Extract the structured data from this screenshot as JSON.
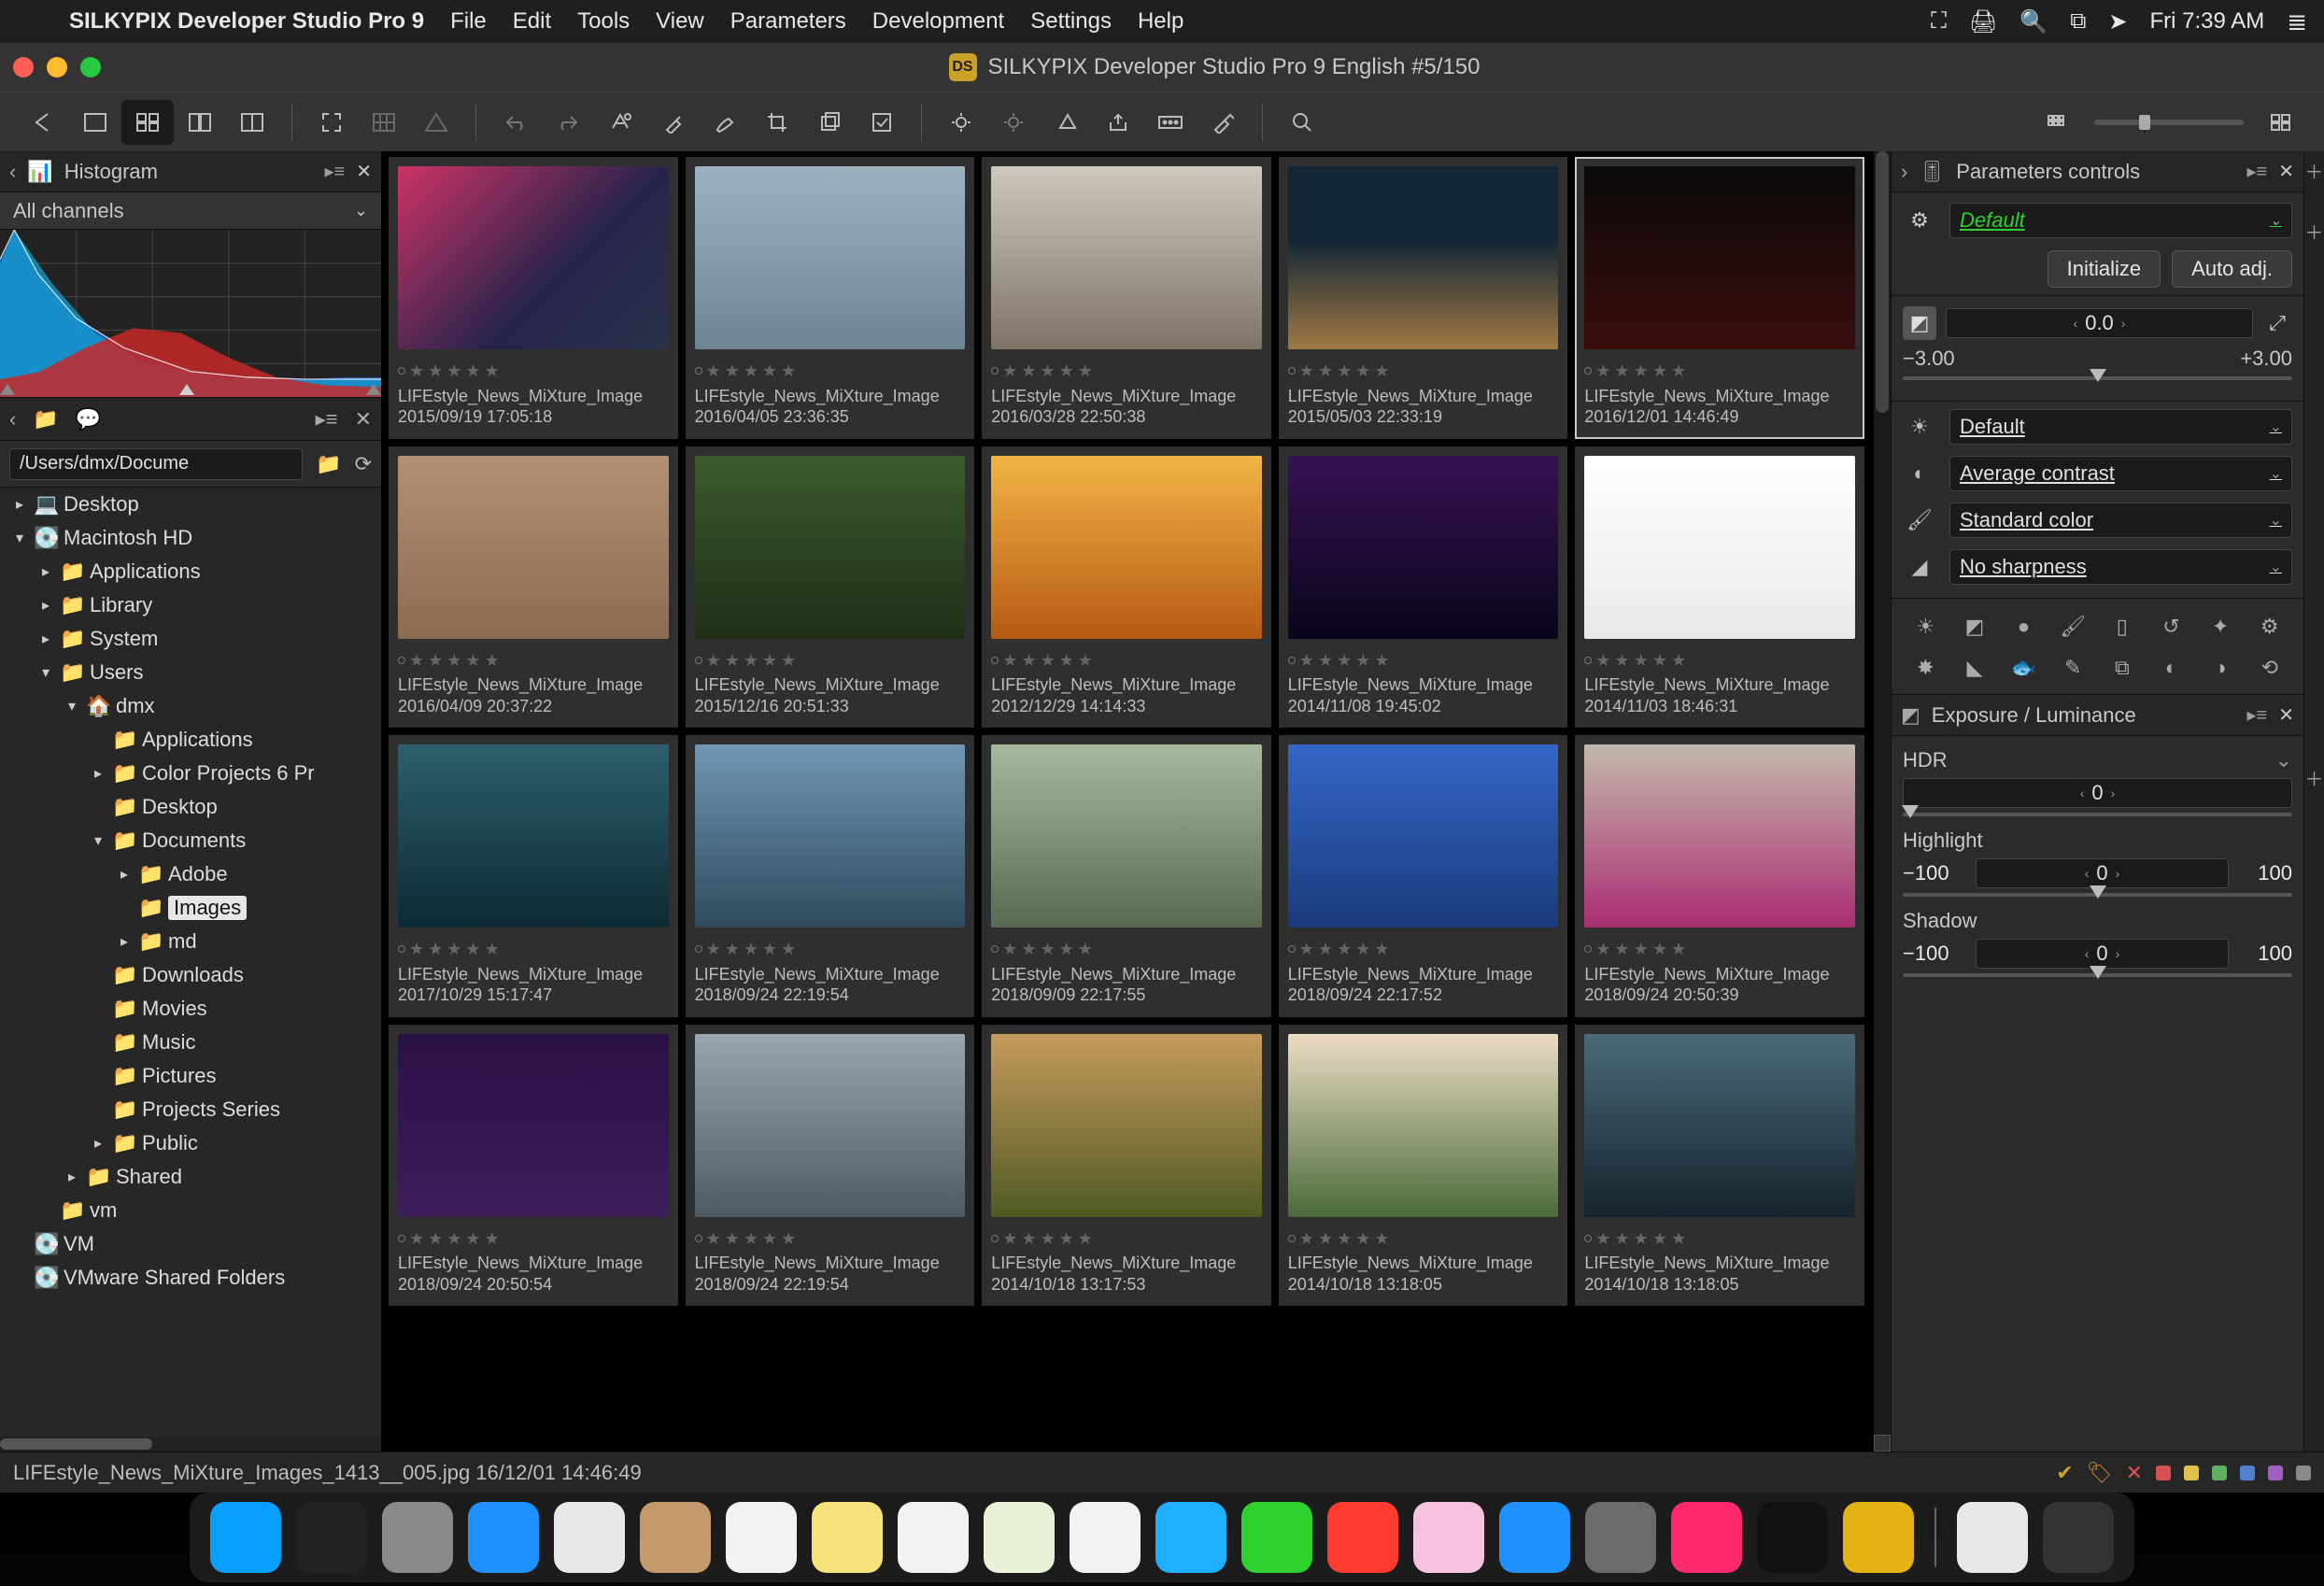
{
  "menubar": {
    "app_name": "SILKYPIX Developer Studio Pro 9",
    "items": [
      "File",
      "Edit",
      "Tools",
      "View",
      "Parameters",
      "Development",
      "Settings",
      "Help"
    ],
    "clock": "Fri 7:39 AM"
  },
  "window": {
    "badge": "DS",
    "title": "SILKYPIX Developer Studio Pro 9 English   #5/150"
  },
  "histogram": {
    "title": "Histogram",
    "channels_label": "All channels"
  },
  "path": "/Users/dmx/Docume",
  "folder_tree": [
    {
      "depth": 0,
      "exp": "▸",
      "ico": "💻",
      "label": "Desktop"
    },
    {
      "depth": 0,
      "exp": "▾",
      "ico": "💽",
      "label": "Macintosh HD"
    },
    {
      "depth": 1,
      "exp": "▸",
      "ico": "📁",
      "label": "Applications"
    },
    {
      "depth": 1,
      "exp": "▸",
      "ico": "📁",
      "label": "Library"
    },
    {
      "depth": 1,
      "exp": "▸",
      "ico": "📁",
      "label": "System"
    },
    {
      "depth": 1,
      "exp": "▾",
      "ico": "📁",
      "label": "Users"
    },
    {
      "depth": 2,
      "exp": "▾",
      "ico": "🏠",
      "label": "dmx"
    },
    {
      "depth": 3,
      "exp": " ",
      "ico": "📁",
      "label": "Applications"
    },
    {
      "depth": 3,
      "exp": "▸",
      "ico": "📁",
      "label": "Color Projects 6 Pr"
    },
    {
      "depth": 3,
      "exp": " ",
      "ico": "📁",
      "label": "Desktop"
    },
    {
      "depth": 3,
      "exp": "▾",
      "ico": "📁",
      "label": "Documents"
    },
    {
      "depth": 4,
      "exp": "▸",
      "ico": "📁",
      "label": "Adobe"
    },
    {
      "depth": 4,
      "exp": " ",
      "ico": "📁",
      "label": "Images",
      "selected": true
    },
    {
      "depth": 4,
      "exp": "▸",
      "ico": "📁",
      "label": "md"
    },
    {
      "depth": 3,
      "exp": " ",
      "ico": "📁",
      "label": "Downloads"
    },
    {
      "depth": 3,
      "exp": " ",
      "ico": "📁",
      "label": "Movies"
    },
    {
      "depth": 3,
      "exp": " ",
      "ico": "📁",
      "label": "Music"
    },
    {
      "depth": 3,
      "exp": " ",
      "ico": "📁",
      "label": "Pictures"
    },
    {
      "depth": 3,
      "exp": " ",
      "ico": "📁",
      "label": "Projects Series"
    },
    {
      "depth": 3,
      "exp": "▸",
      "ico": "📁",
      "label": "Public"
    },
    {
      "depth": 2,
      "exp": "▸",
      "ico": "📁",
      "label": "Shared"
    },
    {
      "depth": 1,
      "exp": " ",
      "ico": "📁",
      "label": "vm"
    },
    {
      "depth": 0,
      "exp": " ",
      "ico": "💽",
      "label": "VM"
    },
    {
      "depth": 0,
      "exp": " ",
      "ico": "💽",
      "label": "VMware Shared Folders"
    }
  ],
  "thumbnails": [
    {
      "name": "LIFEstyle_News_MiXture_Image",
      "date": "2015/09/19 17:05:18",
      "img": "img-bg1"
    },
    {
      "name": "LIFEstyle_News_MiXture_Image",
      "date": "2016/04/05 23:36:35",
      "img": "img-bg2"
    },
    {
      "name": "LIFEstyle_News_MiXture_Image",
      "date": "2016/03/28 22:50:38",
      "img": "img-bg3"
    },
    {
      "name": "LIFEstyle_News_MiXture_Image",
      "date": "2015/05/03 22:33:19",
      "img": "img-bg4"
    },
    {
      "name": "LIFEstyle_News_MiXture_Image",
      "date": "2016/12/01 14:46:49",
      "img": "img-bg5",
      "active": true
    },
    {
      "name": "LIFEstyle_News_MiXture_Image",
      "date": "2016/04/09 20:37:22",
      "img": "img-bg6"
    },
    {
      "name": "LIFEstyle_News_MiXture_Image",
      "date": "2015/12/16 20:51:33",
      "img": "img-bg7"
    },
    {
      "name": "LIFEstyle_News_MiXture_Image",
      "date": "2012/12/29 14:14:33",
      "img": "img-bg8"
    },
    {
      "name": "LIFEstyle_News_MiXture_Image",
      "date": "2014/11/08 19:45:02",
      "img": "img-bg9"
    },
    {
      "name": "LIFEstyle_News_MiXture_Image",
      "date": "2014/11/03 18:46:31",
      "img": "img-bg10"
    },
    {
      "name": "LIFEstyle_News_MiXture_Image",
      "date": "2017/10/29 15:17:47",
      "img": "img-bg11"
    },
    {
      "name": "LIFEstyle_News_MiXture_Image",
      "date": "2018/09/24 22:19:54",
      "img": "img-bg12"
    },
    {
      "name": "LIFEstyle_News_MiXture_Image",
      "date": "2018/09/09 22:17:55",
      "img": "img-bg13"
    },
    {
      "name": "LIFEstyle_News_MiXture_Image",
      "date": "2018/09/24 22:17:52",
      "img": "img-bg14"
    },
    {
      "name": "LIFEstyle_News_MiXture_Image",
      "date": "2018/09/24 20:50:39",
      "img": "img-bg15"
    },
    {
      "name": "LIFEstyle_News_MiXture_Image",
      "date": "2018/09/24 20:50:54",
      "img": "img-bg16"
    },
    {
      "name": "LIFEstyle_News_MiXture_Image",
      "date": "2018/09/24 22:19:54",
      "img": "img-bg17"
    },
    {
      "name": "LIFEstyle_News_MiXture_Image",
      "date": "2014/10/18 13:17:53",
      "img": "img-bg18"
    },
    {
      "name": "LIFEstyle_News_MiXture_Image",
      "date": "2014/10/18 13:18:05",
      "img": "img-bg19"
    },
    {
      "name": "LIFEstyle_News_MiXture_Image",
      "date": "2014/10/18 13:18:05",
      "img": "img-bg20"
    }
  ],
  "params": {
    "title": "Parameters controls",
    "default_label": "Default",
    "initialize_label": "Initialize",
    "auto_adj_label": "Auto adj.",
    "exposure": {
      "value": "0.0",
      "min": "−3.00",
      "max": "+3.00"
    },
    "wb_label": "Default",
    "contrast_label": "Average contrast",
    "color_label": "Standard color",
    "sharp_label": "No sharpness"
  },
  "expo_panel": {
    "title": "Exposure / Luminance",
    "hdr_label": "HDR",
    "hdr_value": "0",
    "highlight_label": "Highlight",
    "highlight_min": "−100",
    "highlight_value": "0",
    "highlight_max": "100",
    "shadow_label": "Shadow",
    "shadow_min": "−100",
    "shadow_value": "0",
    "shadow_max": "100"
  },
  "status": {
    "text": "LIFEstyle_News_MiXture_Images_1413__005.jpg 16/12/01 14:46:49"
  },
  "dock": [
    {
      "name": "finder",
      "color": "#07a0ff"
    },
    {
      "name": "siri",
      "color": "#222"
    },
    {
      "name": "launchpad",
      "color": "#8a8a8a"
    },
    {
      "name": "safari",
      "color": "#1e90ff"
    },
    {
      "name": "mail",
      "color": "#e8e8e8"
    },
    {
      "name": "contacts",
      "color": "#c49a6c"
    },
    {
      "name": "calendar",
      "color": "#f2f2f2"
    },
    {
      "name": "notes",
      "color": "#f7e27c"
    },
    {
      "name": "reminders",
      "color": "#f2f2f2"
    },
    {
      "name": "maps",
      "color": "#e8f2d8"
    },
    {
      "name": "photos",
      "color": "#f2f2f2"
    },
    {
      "name": "messages",
      "color": "#1eb0ff"
    },
    {
      "name": "facetime",
      "color": "#2fd12f"
    },
    {
      "name": "news",
      "color": "#ff3b30"
    },
    {
      "name": "music",
      "color": "#f5c2e0"
    },
    {
      "name": "appstore",
      "color": "#1e90ff"
    },
    {
      "name": "system-prefs",
      "color": "#6b6b6b"
    },
    {
      "name": "cleanmymac",
      "color": "#ff2a6d"
    },
    {
      "name": "activity",
      "color": "#111"
    },
    {
      "name": "silkypix",
      "color": "#e3b213"
    },
    {
      "name": "sep",
      "sep": true
    },
    {
      "name": "generic-doc",
      "color": "#e8e8e8"
    },
    {
      "name": "trash",
      "color": "#333"
    }
  ],
  "colors": {
    "label_red": "#d95050",
    "label_yellow": "#dfc24a",
    "label_green": "#5fb060",
    "label_blue": "#5080d0",
    "label_purple": "#a060c0",
    "label_gray": "#8a8a8a"
  }
}
